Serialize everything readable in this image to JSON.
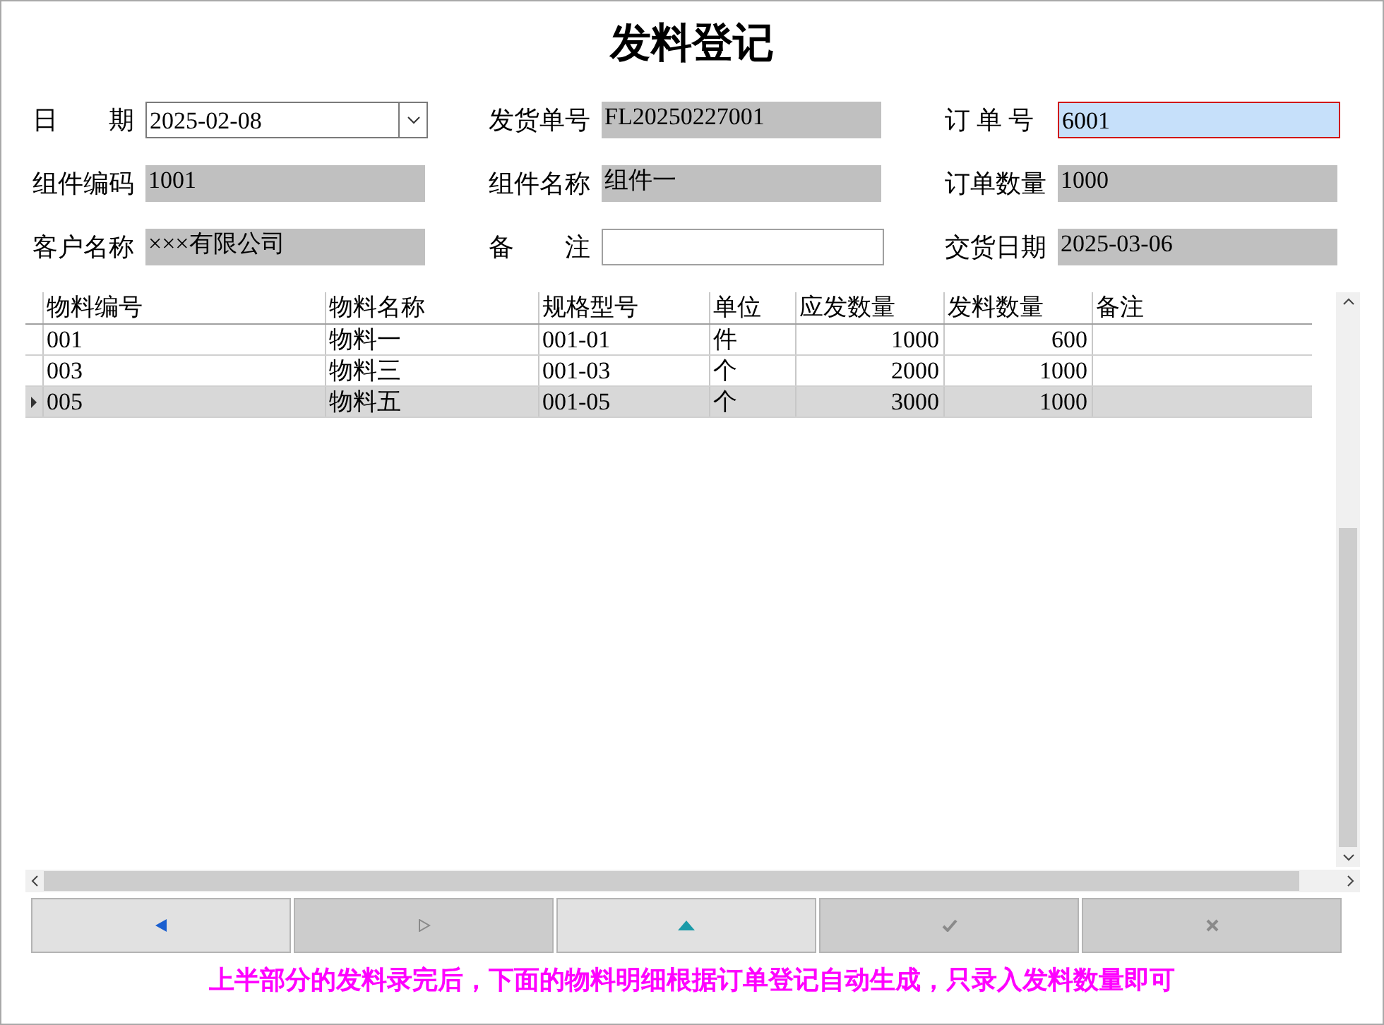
{
  "window": {
    "title": "发料登记"
  },
  "form": [
    {
      "label": "日　　期",
      "kind": "date",
      "value": "2025-02-08"
    },
    {
      "label": "发货单号",
      "kind": "readonly",
      "value": "FL20250227001"
    },
    {
      "label": "订 单 号",
      "kind": "input",
      "focused": true,
      "value": "6001"
    },
    {
      "label": "组件编码",
      "kind": "readonly",
      "value": "1001"
    },
    {
      "label": "组件名称",
      "kind": "readonly",
      "value": "组件一"
    },
    {
      "label": "订单数量",
      "kind": "readonly",
      "value": "1000"
    },
    {
      "label": "客户名称",
      "kind": "readonly",
      "value": "×××有限公司"
    },
    {
      "label": "备　　注",
      "kind": "input",
      "focused": false
    },
    {
      "label": "交货日期",
      "kind": "readonly",
      "value": "2025-03-06"
    }
  ],
  "table": {
    "columns": [
      {
        "label": "物料编号",
        "kind": "text"
      },
      {
        "label": "物料名称",
        "kind": "text"
      },
      {
        "label": "规格型号",
        "kind": "text"
      },
      {
        "label": "单位",
        "kind": "text"
      },
      {
        "label": "应发数量",
        "kind": "number"
      },
      {
        "label": "发料数量",
        "kind": "number"
      },
      {
        "label": "备注",
        "kind": "text"
      }
    ],
    "rows": [
      {
        "selected": false,
        "cells": [
          "001",
          "物料一",
          "001-01",
          "件",
          "1000",
          "600"
        ]
      },
      {
        "selected": false,
        "cells": [
          "003",
          "物料三",
          "001-03",
          "个",
          "2000",
          "1000"
        ]
      },
      {
        "selected": true,
        "cells": [
          "005",
          "物料五",
          "001-05",
          "个",
          "3000",
          "1000"
        ]
      }
    ]
  },
  "toolbar": [
    {
      "kind": "previous",
      "disabled": false
    },
    {
      "kind": "next",
      "disabled": true
    },
    {
      "kind": "up",
      "disabled": false
    },
    {
      "kind": "confirm",
      "disabled": true
    },
    {
      "kind": "cancel",
      "disabled": true
    }
  ],
  "footer_note": "上半部分的发料录完后，下面的物料明细根据订单登记自动生成，只录入发料数量即可"
}
